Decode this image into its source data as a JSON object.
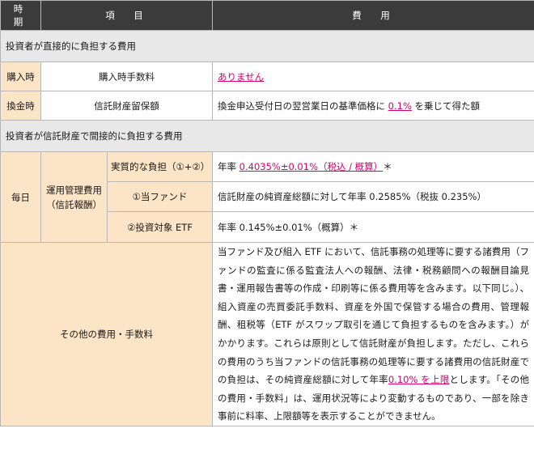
{
  "header": {
    "period": "時　期",
    "item": "項　目",
    "cost": "費　用"
  },
  "section_direct": "投資者が直接的に負担する費用",
  "purchase": {
    "period": "購入時",
    "item": "購入時手数料",
    "value": "ありません"
  },
  "redemption": {
    "period": "換金時",
    "item": "信託財産留保額",
    "value_pre": "換金申込受付日の翌営業日の基準価格に ",
    "value_rate": "0.1%",
    "value_post": " を乗じて得た額"
  },
  "section_indirect": "投資者が信託財産で間接的に負担する費用",
  "daily": {
    "period": "毎日",
    "item": "運用管理費用（信託報酬）",
    "effective": {
      "label": "実質的な負担（①+②）",
      "pre": "年率 ",
      "rate": "0.4035%±0.01%（税込 / 概算）",
      "post": "＊"
    },
    "fund": {
      "label": "①当ファンド",
      "value": "信託財産の純資産総額に対して年率 0.2585%（税抜 0.235%）"
    },
    "etf": {
      "label": "②投資対象 ETF",
      "value": "年率 0.145%±0.01%（概算）＊"
    }
  },
  "other": {
    "label": "その他の費用・手数料",
    "text_pre": "当ファンド及び組入 ETF において、信託事務の処理等に要する諸費用（ファンドの監査に係る監査法人への報酬、法律・税務顧問への報酬目論見書・運用報告書等の作成・印刷等に係る費用等を含みます。以下同じ。）、組入資産の売買委託手数料、資産を外国で保管する場合の費用、管理報酬、租税等（ETF がスワップ取引を通じて負担するものを含みます。）がかかります。これらは原則として信託財産が負担します。ただし、これらの費用のうち当ファンドの信託事務の処理等に要する諸費用の信託財産での負担は、その純資産総額に対して年率",
    "text_rate": "0.10% を上限",
    "text_post": "とします。「その他の費用・手数料」は、運用状況等により変動するものであり、一部を除き事前に料率、上限額等を表示することができません。"
  },
  "colors": {
    "header_bg": "#3b3b3b",
    "peach": "#fce4c6",
    "section_bg": "#e8e8e8",
    "accent": "#d0006f"
  }
}
